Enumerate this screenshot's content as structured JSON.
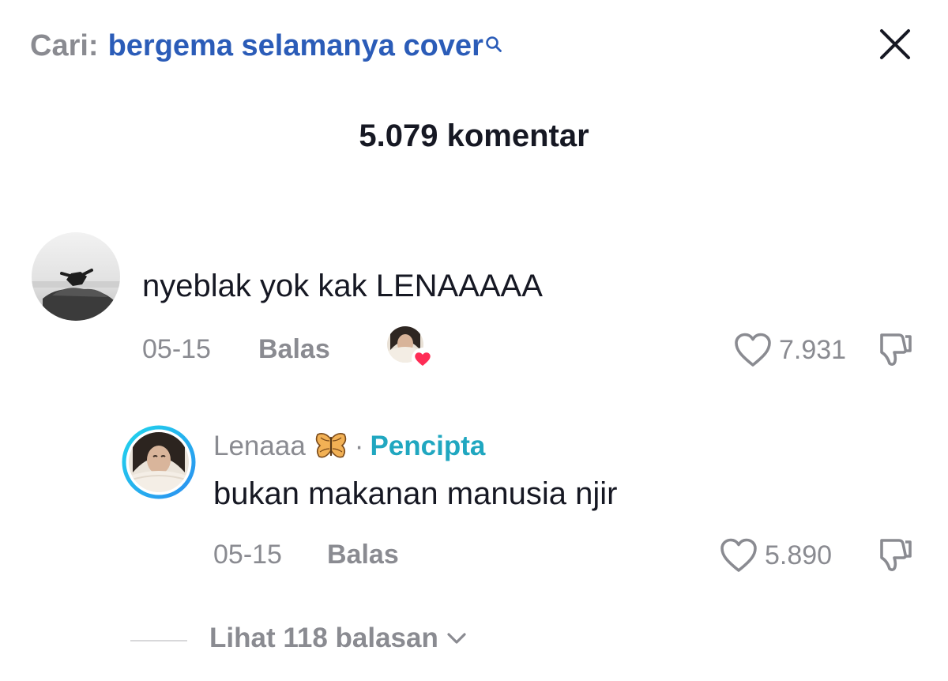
{
  "search": {
    "prefix": "Cari:",
    "query": "bergema selamanya cover"
  },
  "header": {
    "comment_count": "5.079 komentar"
  },
  "comments": [
    {
      "text": "nyeblak yok kak LENAAAAA",
      "date": "05-15",
      "reply_label": "Balas",
      "likes": "7.931",
      "liked_by_creator": true,
      "icons": {
        "like": "heart-outline-icon",
        "dislike": "thumb-down-icon",
        "creator_like": "creator-liked-heart-icon"
      }
    }
  ],
  "reply": {
    "username": "Lenaaa",
    "username_icon": "butterfly-icon",
    "separator": "·",
    "badge": "Pencipta",
    "text": "bukan makanan manusia njir",
    "date": "05-15",
    "reply_label": "Balas",
    "likes": "5.890"
  },
  "view_replies": {
    "label": "Lihat 118 balasan",
    "icon": "chevron-down-icon"
  },
  "colors": {
    "search_query": "#2b5cb8",
    "creator_badge": "#20a7c0",
    "heart_red": "#fe2c55",
    "muted_text": "#8a8b91",
    "creator_ring_start": "#20d5ec",
    "creator_ring_end": "#2b8ff0"
  }
}
